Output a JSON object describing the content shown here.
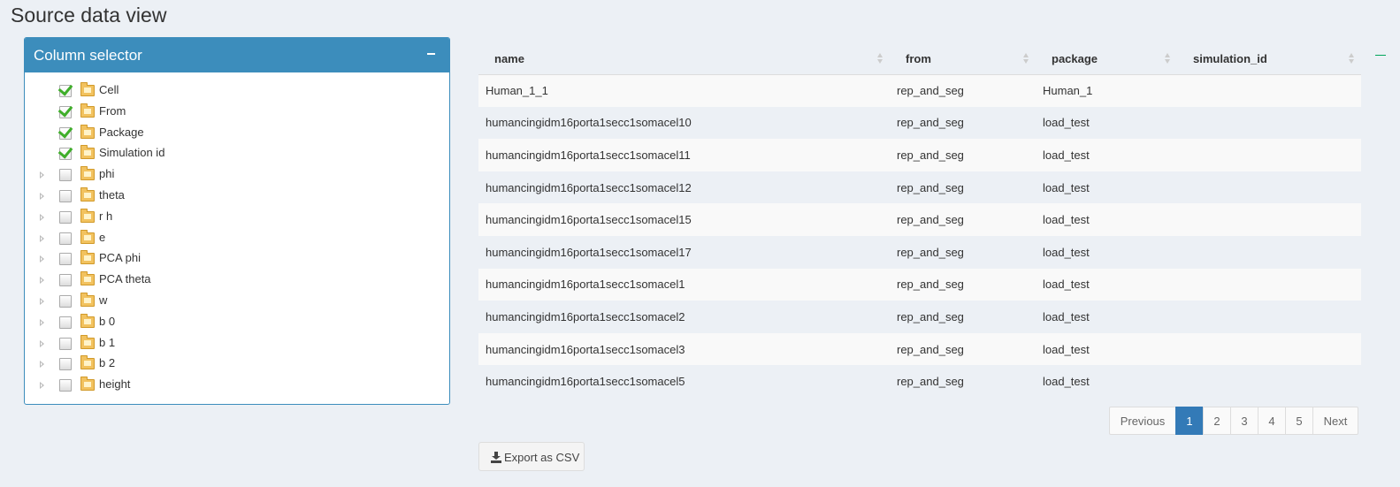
{
  "page": {
    "title": "Source data view"
  },
  "column_selector": {
    "title": "Column selector",
    "items": [
      {
        "label": "Cell",
        "checked": true,
        "expandable": false
      },
      {
        "label": "From",
        "checked": true,
        "expandable": false
      },
      {
        "label": "Package",
        "checked": true,
        "expandable": false
      },
      {
        "label": "Simulation id",
        "checked": true,
        "expandable": false
      },
      {
        "label": "phi",
        "checked": false,
        "expandable": true
      },
      {
        "label": "theta",
        "checked": false,
        "expandable": true
      },
      {
        "label": "r h",
        "checked": false,
        "expandable": true
      },
      {
        "label": "e",
        "checked": false,
        "expandable": true
      },
      {
        "label": "PCA phi",
        "checked": false,
        "expandable": true
      },
      {
        "label": "PCA theta",
        "checked": false,
        "expandable": true
      },
      {
        "label": "w",
        "checked": false,
        "expandable": true
      },
      {
        "label": "b 0",
        "checked": false,
        "expandable": true
      },
      {
        "label": "b 1",
        "checked": false,
        "expandable": true
      },
      {
        "label": "b 2",
        "checked": false,
        "expandable": true
      },
      {
        "label": "height",
        "checked": false,
        "expandable": true
      }
    ]
  },
  "table": {
    "columns": [
      "name",
      "from",
      "package",
      "simulation_id"
    ],
    "rows": [
      [
        "Human_1_1",
        "rep_and_seg",
        "Human_1",
        ""
      ],
      [
        "humancingidm16porta1secc1somacel10",
        "rep_and_seg",
        "load_test",
        ""
      ],
      [
        "humancingidm16porta1secc1somacel11",
        "rep_and_seg",
        "load_test",
        ""
      ],
      [
        "humancingidm16porta1secc1somacel12",
        "rep_and_seg",
        "load_test",
        ""
      ],
      [
        "humancingidm16porta1secc1somacel15",
        "rep_and_seg",
        "load_test",
        ""
      ],
      [
        "humancingidm16porta1secc1somacel17",
        "rep_and_seg",
        "load_test",
        ""
      ],
      [
        "humancingidm16porta1secc1somacel1",
        "rep_and_seg",
        "load_test",
        ""
      ],
      [
        "humancingidm16porta1secc1somacel2",
        "rep_and_seg",
        "load_test",
        ""
      ],
      [
        "humancingidm16porta1secc1somacel3",
        "rep_and_seg",
        "load_test",
        ""
      ],
      [
        "humancingidm16porta1secc1somacel5",
        "rep_and_seg",
        "load_test",
        ""
      ]
    ]
  },
  "pagination": {
    "previous_label": "Previous",
    "next_label": "Next",
    "pages": [
      "1",
      "2",
      "3",
      "4",
      "5"
    ],
    "active_page": "1"
  },
  "export": {
    "label": "Export as CSV"
  },
  "colors": {
    "accent": "#3c8dbc",
    "active_page": "#337ab7",
    "checkmark": "#3fae2a",
    "background": "#ecf0f5"
  },
  "icons": {
    "collapse": "minus-icon",
    "expander": "triangle-right-icon",
    "folder": "folder-icon",
    "checked": "checkmark-icon",
    "sort": "sort-icon",
    "export": "download-icon"
  }
}
